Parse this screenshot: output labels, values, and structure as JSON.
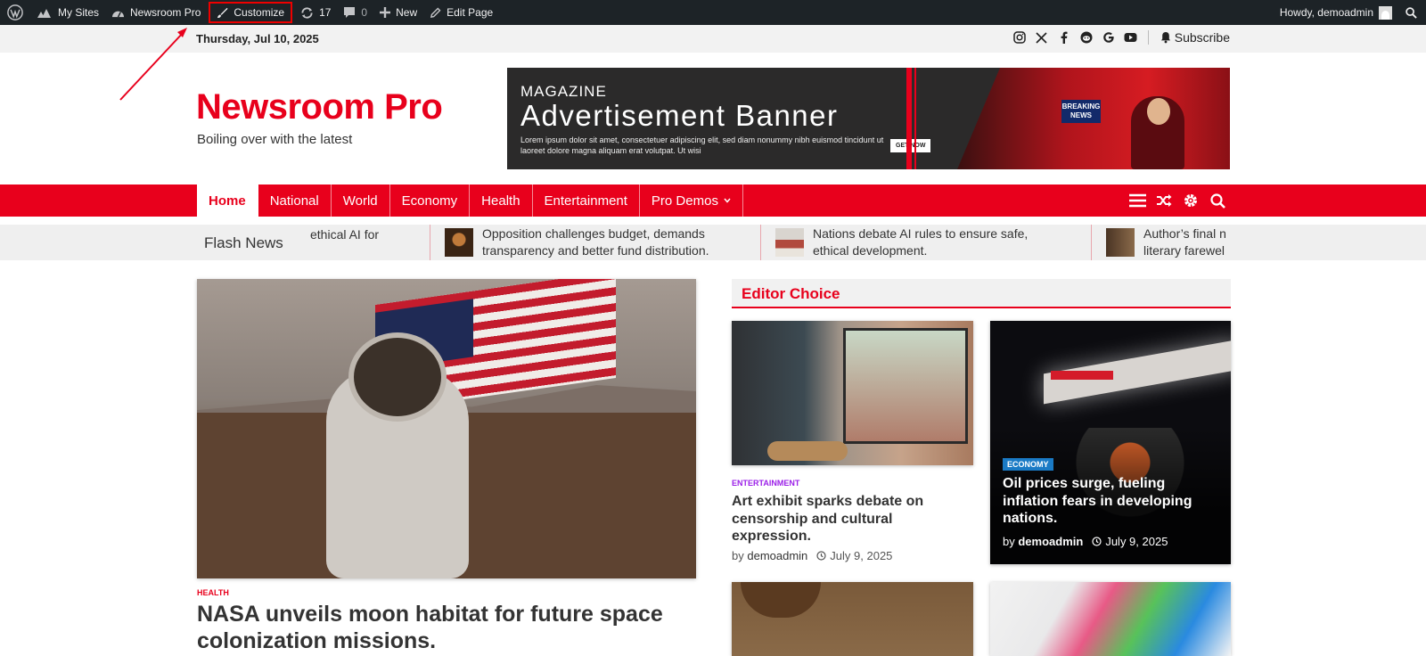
{
  "adminbar": {
    "items": [
      {
        "label": "My Sites",
        "icon": "my-sites-icon"
      },
      {
        "label": "Newsroom Pro",
        "icon": "dashboard-icon"
      },
      {
        "label": "Customize",
        "icon": "brush-icon"
      },
      {
        "label": "17",
        "icon": "updates-icon"
      },
      {
        "label": "0",
        "icon": "comments-icon"
      },
      {
        "label": "New",
        "icon": "plus-icon"
      },
      {
        "label": "Edit Page",
        "icon": "pencil-icon"
      }
    ],
    "howdy": "Howdy, demoadmin"
  },
  "topbar": {
    "date": "Thursday, Jul 10, 2025",
    "social": [
      "instagram-icon",
      "x-icon",
      "facebook-icon",
      "reddit-icon",
      "google-icon",
      "youtube-icon"
    ],
    "subscribe": "Subscribe"
  },
  "site": {
    "title": "Newsroom Pro",
    "tagline": "Boiling over with the latest"
  },
  "banner": {
    "kicker": "MAGAZINE",
    "title": "Advertisement Banner",
    "text": "Lorem ipsum dolor sit amet, consectetuer adipiscing elit, sed diam nonummy nibh euismod tincidunt ut laoreet dolore magna aliquam erat volutpat. Ut wisi",
    "button": "GET NOW",
    "badge": "BREAKING NEWS"
  },
  "nav": {
    "items": [
      "Home",
      "National",
      "World",
      "Economy",
      "Health",
      "Entertainment",
      "Pro Demos"
    ],
    "icons": [
      "menu-icon",
      "shuffle-icon",
      "settings-icon",
      "search-icon"
    ]
  },
  "flash": {
    "label": "Flash News",
    "items": [
      {
        "line1": "ethical AI for",
        "line2": ""
      },
      {
        "line1": "Opposition challenges budget, demands",
        "line2": "transparency and better fund distribution."
      },
      {
        "line1": "Nations debate AI rules to ensure safe,",
        "line2": "ethical development."
      },
      {
        "line1": "Author’s final n",
        "line2": "literary farewel"
      }
    ]
  },
  "hero": {
    "category": "HEALTH",
    "title": "NASA unveils moon habitat for future space colonization missions."
  },
  "editor": {
    "heading": "Editor Choice",
    "card1": {
      "category": "ENTERTAINMENT",
      "title": "Art exhibit sparks debate on censorship and cultural expression.",
      "author": "demoadmin",
      "by": "by",
      "date": "July 9, 2025"
    },
    "card2": {
      "category": "ECONOMY",
      "title": "Oil prices surge, fueling inflation fears in developing nations.",
      "author": "demoadmin",
      "by": "by",
      "date": "July 9, 2025"
    }
  },
  "colors": {
    "brand": "#e8001c",
    "adminbar": "#1d2327",
    "entertainment_tag": "#9b1fe8",
    "economy_tag": "#1a7ac5"
  }
}
